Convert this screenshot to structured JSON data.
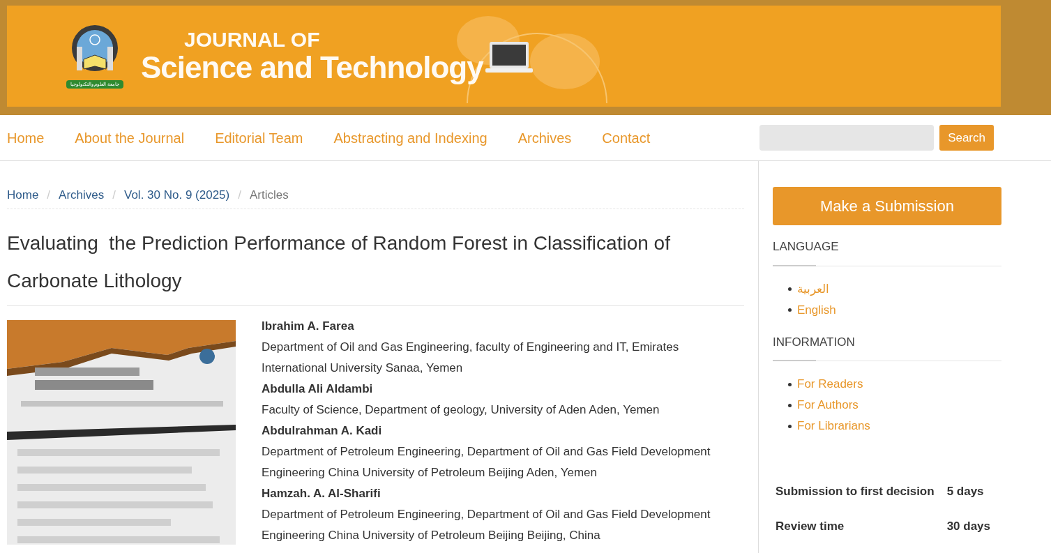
{
  "banner": {
    "title_line_1": "JOURNAL OF",
    "title_line_2": "Science and Technology",
    "logo_ribbon": "جامعة العلوم والتكنولوجيا"
  },
  "nav": {
    "links": [
      {
        "label": "Home"
      },
      {
        "label": "About the Journal"
      },
      {
        "label": "Editorial Team"
      },
      {
        "label": "Abstracting and Indexing"
      },
      {
        "label": "Archives"
      },
      {
        "label": "Contact"
      }
    ],
    "search_button": "Search"
  },
  "breadcrumb_separator": "/",
  "breadcrumb": [
    {
      "label": "Home",
      "kind": "link"
    },
    {
      "label": "Archives",
      "kind": "link"
    },
    {
      "label": "Vol. 30 No. 9 (2025)",
      "kind": "link"
    },
    {
      "label": "Articles",
      "kind": "current"
    }
  ],
  "article": {
    "title": "Evaluating  the Prediction Performance of Random Forest in Classification of Carbonate Lithology",
    "authors": [
      {
        "name": "Ibrahim A. Farea",
        "affiliation": "Department of Oil and Gas Engineering, faculty of Engineering and IT, Emirates International University Sanaa, Yemen"
      },
      {
        "name": "Abdulla Ali Aldambi",
        "affiliation": "Faculty of Science, Department of geology, University of Aden Aden, Yemen"
      },
      {
        "name": "Abdulrahman A. Kadi",
        "affiliation": "Department of Petroleum Engineering, Department of Oil and Gas Field Development Engineering China University of Petroleum Beijing Aden, Yemen"
      },
      {
        "name": "Hamzah. A. Al-Sharifi",
        "affiliation": "Department of Petroleum Engineering, Department of Oil and Gas Field Development Engineering China University of Petroleum Beijing Beijing, China"
      }
    ]
  },
  "sidebar": {
    "submit_button": "Make a Submission",
    "blocks": [
      {
        "heading": "LANGUAGE",
        "links": [
          "العربية",
          "English"
        ]
      },
      {
        "heading": "INFORMATION",
        "links": [
          "For Readers",
          "For Authors",
          "For Librarians"
        ]
      }
    ],
    "stats": [
      {
        "label": "Submission to first decision",
        "value": "5 days"
      },
      {
        "label": "Review time",
        "value": "30 days"
      }
    ]
  }
}
